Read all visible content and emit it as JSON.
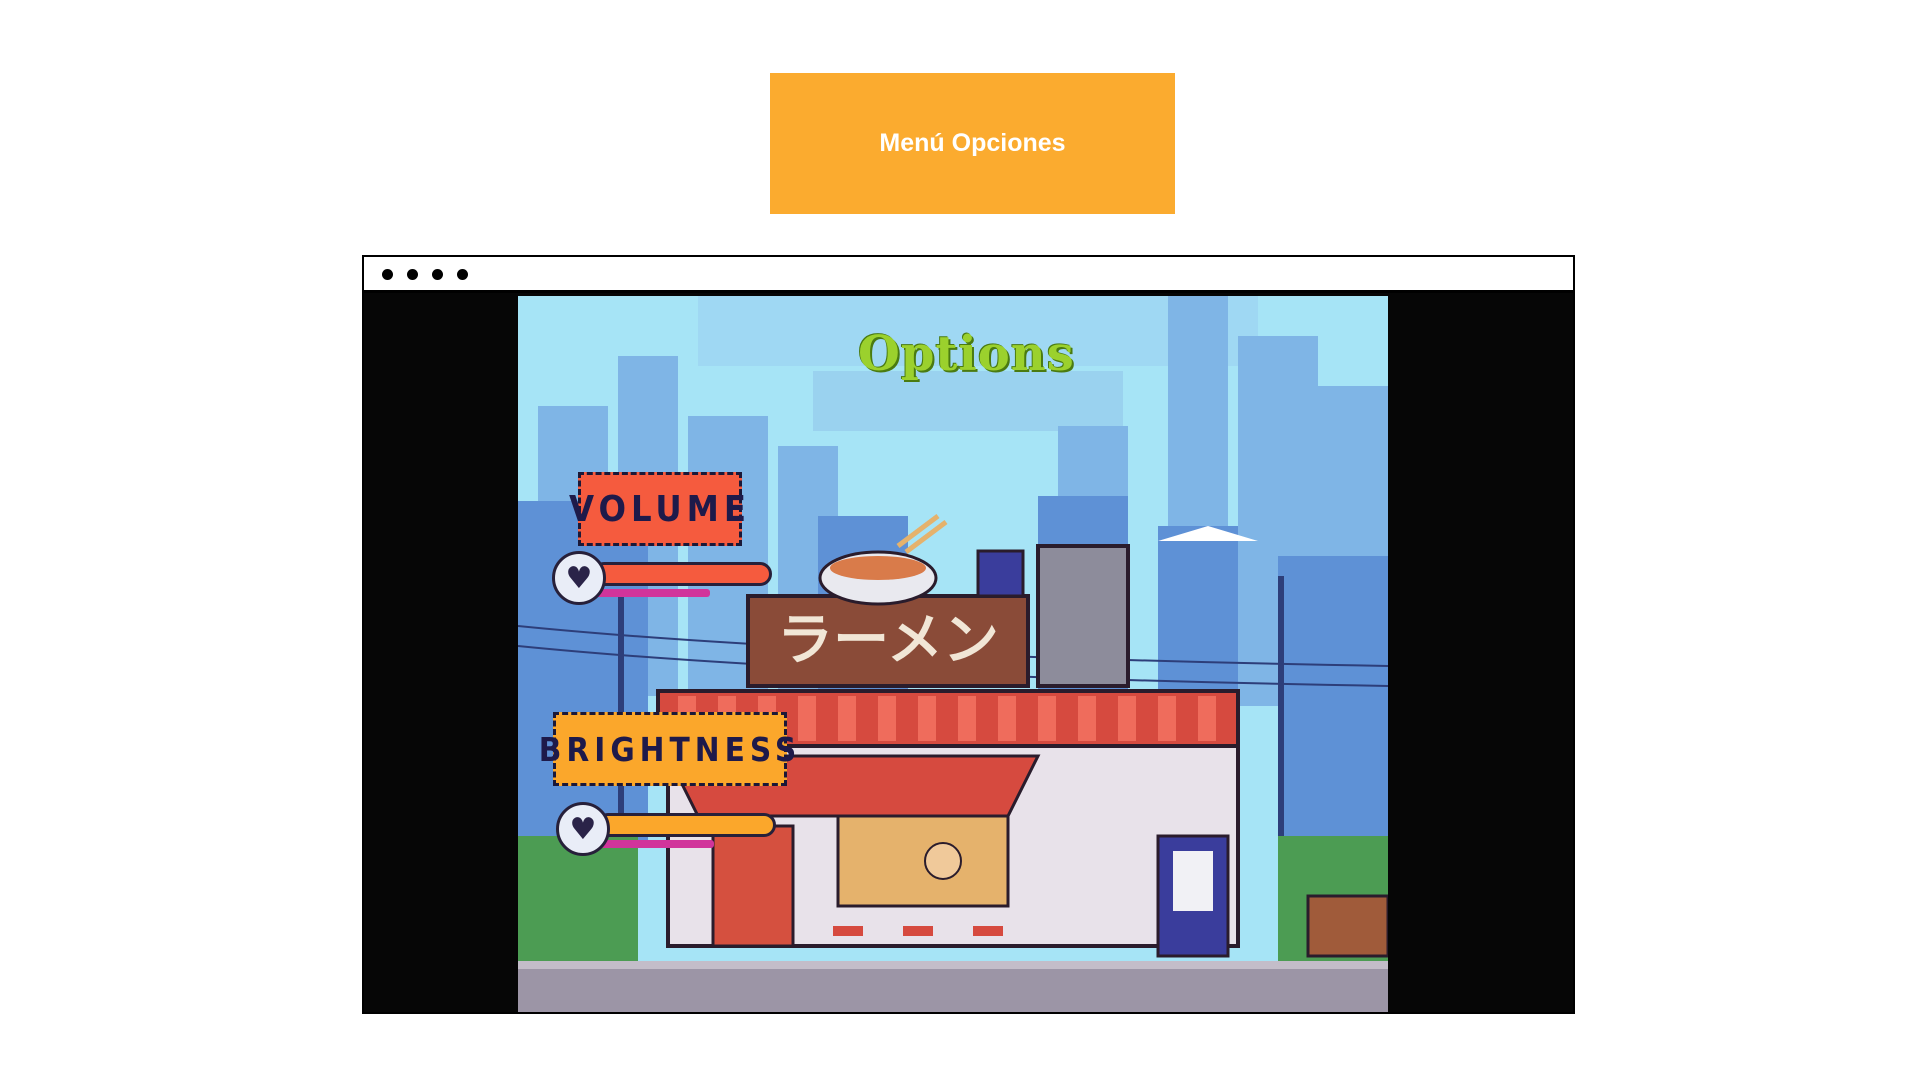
{
  "header": {
    "label": "Menú Opciones",
    "color": "#fbab2f"
  },
  "window": {
    "dots": 4
  },
  "game": {
    "title": "Options",
    "shop_sign": "ラーメン",
    "volume": {
      "label": "VOLUME",
      "level": 0.9,
      "track_color": "#f55b3e",
      "icon": "heart-icon"
    },
    "brightness": {
      "label": "BRIGHTNESS",
      "level": 0.9,
      "track_color": "#fba72b",
      "icon": "heart-icon"
    }
  }
}
